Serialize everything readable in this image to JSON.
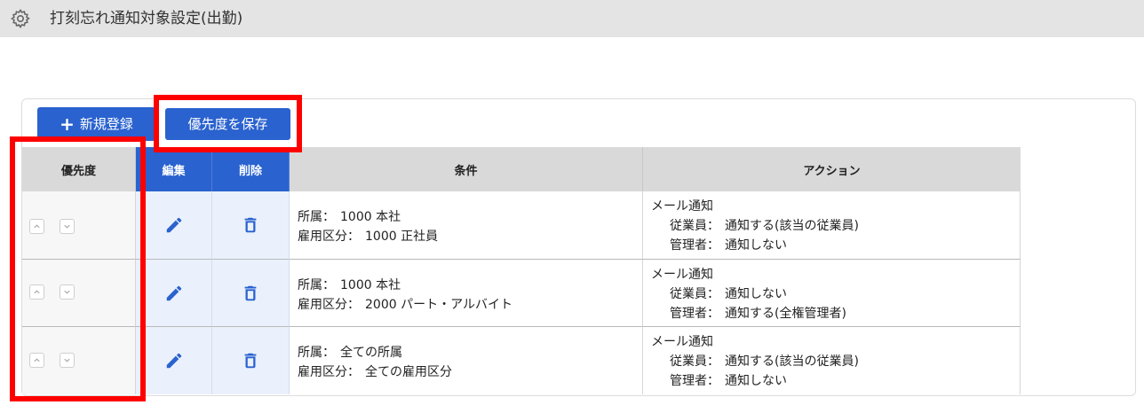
{
  "header": {
    "title": "打刻忘れ通知対象設定(出勤)",
    "icon": "gear-icon"
  },
  "toolbar": {
    "new_label": "新規登録",
    "save_priority_label": "優先度を保存"
  },
  "table": {
    "headers": {
      "priority": "優先度",
      "edit": "編集",
      "delete": "削除",
      "condition": "条件",
      "action": "アクション"
    },
    "rows": [
      {
        "condition": {
          "dept_label": "所属：",
          "dept_value": "1000 本社",
          "emp_label": "雇用区分：",
          "emp_value": "1000 正社員"
        },
        "action": {
          "type": "メール通知",
          "employee_label": "従業員：",
          "employee_value": "通知する(該当の従業員)",
          "manager_label": "管理者：",
          "manager_value": "通知しない"
        }
      },
      {
        "condition": {
          "dept_label": "所属：",
          "dept_value": "1000 本社",
          "emp_label": "雇用区分：",
          "emp_value": "2000 パート・アルバイト"
        },
        "action": {
          "type": "メール通知",
          "employee_label": "従業員：",
          "employee_value": "通知しない",
          "manager_label": "管理者：",
          "manager_value": "通知する(全権管理者)"
        }
      },
      {
        "condition": {
          "dept_label": "所属：",
          "dept_value": "全ての所属",
          "emp_label": "雇用区分：",
          "emp_value": "全ての雇用区分"
        },
        "action": {
          "type": "メール通知",
          "employee_label": "従業員：",
          "employee_value": "通知する(該当の従業員)",
          "manager_label": "管理者：",
          "manager_value": "通知しない"
        }
      }
    ]
  },
  "colors": {
    "primary": "#2a62cf",
    "highlight": "#ff0000",
    "header_gray": "#d9d9d9",
    "edit_cell_bg": "#eaf1fc"
  }
}
